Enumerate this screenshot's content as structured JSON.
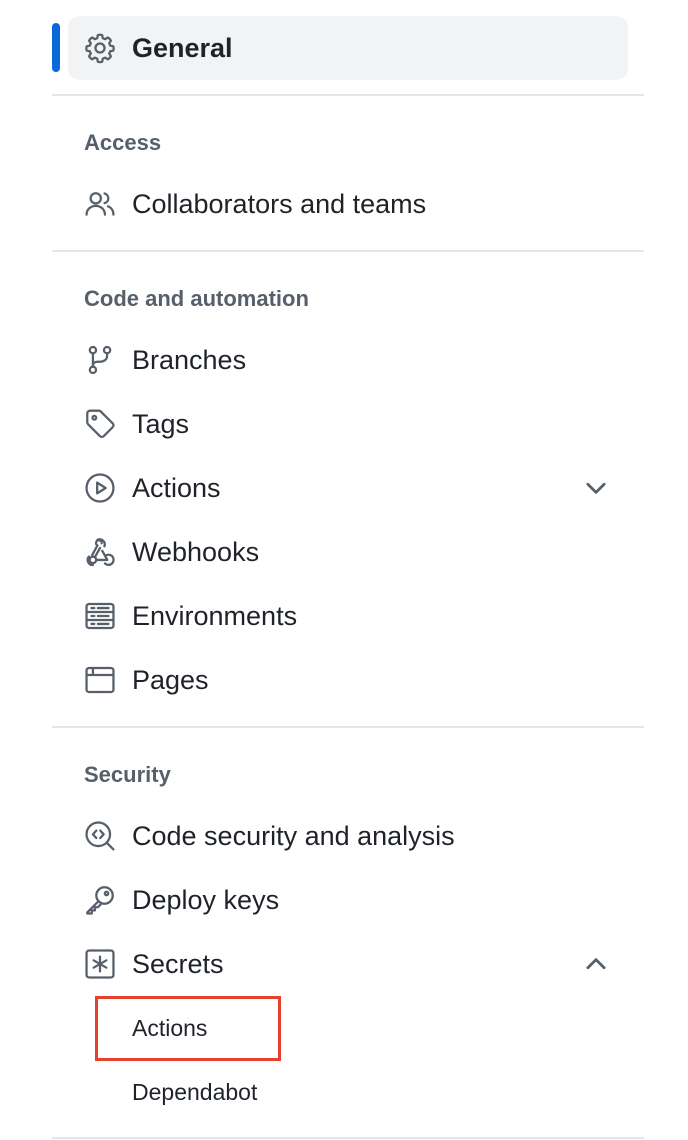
{
  "nav": {
    "general": {
      "label": "General",
      "icon": "gear-icon",
      "active_color": "#0969da"
    },
    "sections": {
      "access": {
        "heading": "Access",
        "items": [
          {
            "label": "Collaborators and teams",
            "icon": "people-icon"
          }
        ]
      },
      "code_automation": {
        "heading": "Code and automation",
        "items": [
          {
            "label": "Branches",
            "icon": "git-branch-icon"
          },
          {
            "label": "Tags",
            "icon": "tag-icon"
          },
          {
            "label": "Actions",
            "icon": "play-icon",
            "expandable": true,
            "expanded": false
          },
          {
            "label": "Webhooks",
            "icon": "webhook-icon"
          },
          {
            "label": "Environments",
            "icon": "server-icon"
          },
          {
            "label": "Pages",
            "icon": "browser-icon"
          }
        ]
      },
      "security": {
        "heading": "Security",
        "items": [
          {
            "label": "Code security and analysis",
            "icon": "codescan-icon"
          },
          {
            "label": "Deploy keys",
            "icon": "key-icon"
          },
          {
            "label": "Secrets",
            "icon": "key-asterisk-icon",
            "expandable": true,
            "expanded": true
          }
        ],
        "secrets_subitems": [
          {
            "label": "Actions",
            "highlighted": true
          },
          {
            "label": "Dependabot"
          }
        ]
      }
    },
    "highlight_color": "#e5412d"
  }
}
